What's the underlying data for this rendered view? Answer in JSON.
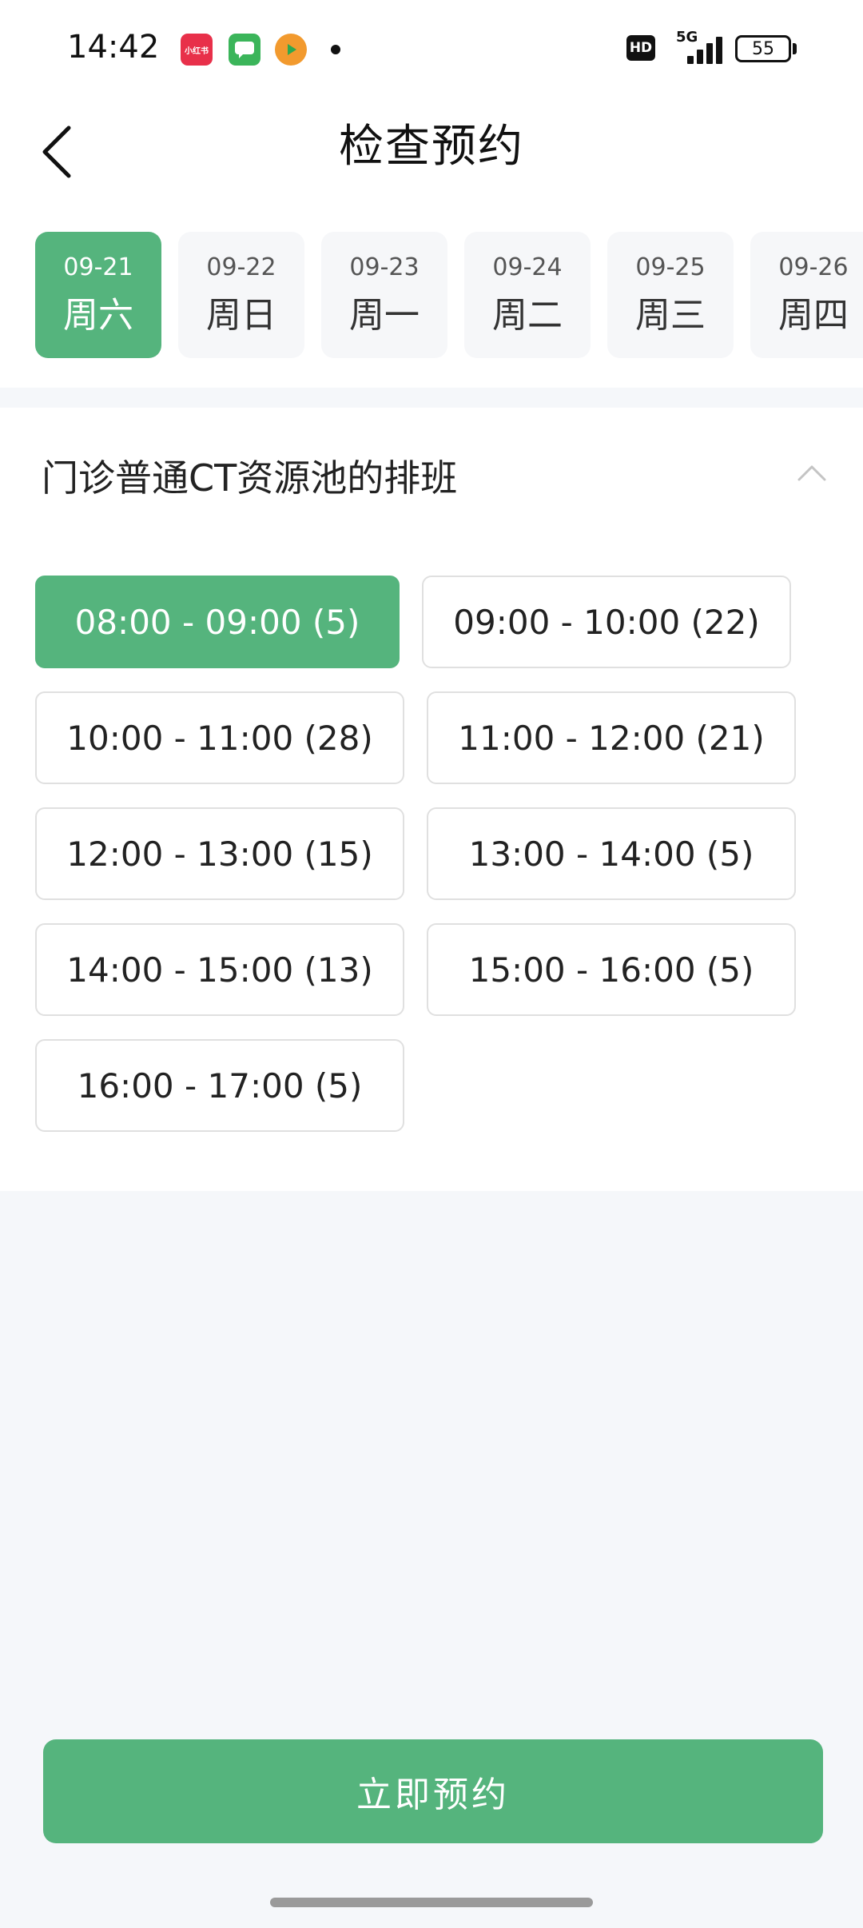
{
  "status_bar": {
    "time": "14:42",
    "apps": [
      "小红书",
      "",
      ""
    ],
    "hd": "HD",
    "network": "5G",
    "battery": "55"
  },
  "header": {
    "title": "检查预约"
  },
  "dates": [
    {
      "date": "09-21",
      "day": "周六",
      "selected": true
    },
    {
      "date": "09-22",
      "day": "周日",
      "selected": false
    },
    {
      "date": "09-23",
      "day": "周一",
      "selected": false
    },
    {
      "date": "09-24",
      "day": "周二",
      "selected": false
    },
    {
      "date": "09-25",
      "day": "周三",
      "selected": false
    },
    {
      "date": "09-26",
      "day": "周四",
      "selected": false
    }
  ],
  "schedule": {
    "title": "门诊普通CT资源池的排班",
    "slots": [
      {
        "label": "08:00 - 09:00 (5)",
        "selected": true
      },
      {
        "label": "09:00 - 10:00 (22)",
        "selected": false
      },
      {
        "label": "10:00 - 11:00 (28)",
        "selected": false
      },
      {
        "label": "11:00 - 12:00 (21)",
        "selected": false
      },
      {
        "label": "12:00 - 13:00 (15)",
        "selected": false
      },
      {
        "label": "13:00 - 14:00 (5)",
        "selected": false
      },
      {
        "label": "14:00 - 15:00 (13)",
        "selected": false
      },
      {
        "label": "15:00 - 16:00 (5)",
        "selected": false
      },
      {
        "label": "16:00 - 17:00 (5)",
        "selected": false
      }
    ]
  },
  "actions": {
    "book_label": "立即预约"
  },
  "colors": {
    "accent": "#55b47d",
    "background": "#f5f7fa"
  }
}
